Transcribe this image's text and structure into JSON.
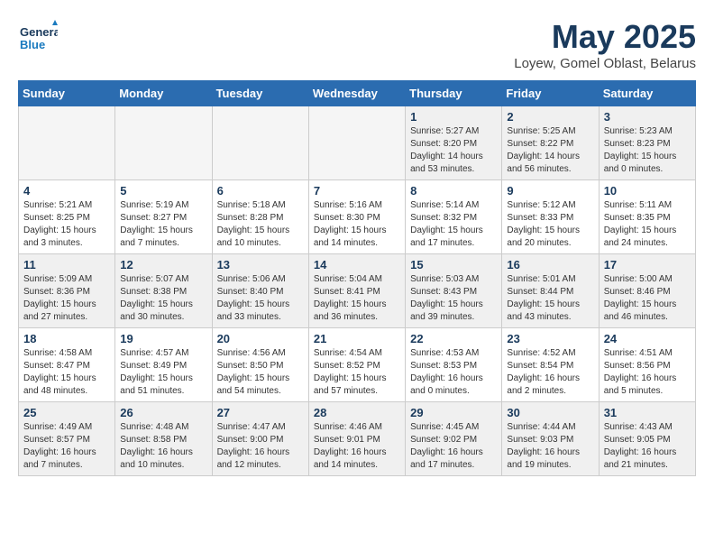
{
  "header": {
    "logo_general": "General",
    "logo_blue": "Blue",
    "month_title": "May 2025",
    "location": "Loyew, Gomel Oblast, Belarus"
  },
  "weekdays": [
    "Sunday",
    "Monday",
    "Tuesday",
    "Wednesday",
    "Thursday",
    "Friday",
    "Saturday"
  ],
  "weeks": [
    [
      {
        "num": "",
        "empty": true
      },
      {
        "num": "",
        "empty": true
      },
      {
        "num": "",
        "empty": true
      },
      {
        "num": "",
        "empty": true
      },
      {
        "num": "1",
        "line1": "Sunrise: 5:27 AM",
        "line2": "Sunset: 8:20 PM",
        "line3": "Daylight: 14 hours",
        "line4": "and 53 minutes."
      },
      {
        "num": "2",
        "line1": "Sunrise: 5:25 AM",
        "line2": "Sunset: 8:22 PM",
        "line3": "Daylight: 14 hours",
        "line4": "and 56 minutes."
      },
      {
        "num": "3",
        "line1": "Sunrise: 5:23 AM",
        "line2": "Sunset: 8:23 PM",
        "line3": "Daylight: 15 hours",
        "line4": "and 0 minutes."
      }
    ],
    [
      {
        "num": "4",
        "line1": "Sunrise: 5:21 AM",
        "line2": "Sunset: 8:25 PM",
        "line3": "Daylight: 15 hours",
        "line4": "and 3 minutes."
      },
      {
        "num": "5",
        "line1": "Sunrise: 5:19 AM",
        "line2": "Sunset: 8:27 PM",
        "line3": "Daylight: 15 hours",
        "line4": "and 7 minutes."
      },
      {
        "num": "6",
        "line1": "Sunrise: 5:18 AM",
        "line2": "Sunset: 8:28 PM",
        "line3": "Daylight: 15 hours",
        "line4": "and 10 minutes."
      },
      {
        "num": "7",
        "line1": "Sunrise: 5:16 AM",
        "line2": "Sunset: 8:30 PM",
        "line3": "Daylight: 15 hours",
        "line4": "and 14 minutes."
      },
      {
        "num": "8",
        "line1": "Sunrise: 5:14 AM",
        "line2": "Sunset: 8:32 PM",
        "line3": "Daylight: 15 hours",
        "line4": "and 17 minutes."
      },
      {
        "num": "9",
        "line1": "Sunrise: 5:12 AM",
        "line2": "Sunset: 8:33 PM",
        "line3": "Daylight: 15 hours",
        "line4": "and 20 minutes."
      },
      {
        "num": "10",
        "line1": "Sunrise: 5:11 AM",
        "line2": "Sunset: 8:35 PM",
        "line3": "Daylight: 15 hours",
        "line4": "and 24 minutes."
      }
    ],
    [
      {
        "num": "11",
        "line1": "Sunrise: 5:09 AM",
        "line2": "Sunset: 8:36 PM",
        "line3": "Daylight: 15 hours",
        "line4": "and 27 minutes."
      },
      {
        "num": "12",
        "line1": "Sunrise: 5:07 AM",
        "line2": "Sunset: 8:38 PM",
        "line3": "Daylight: 15 hours",
        "line4": "and 30 minutes."
      },
      {
        "num": "13",
        "line1": "Sunrise: 5:06 AM",
        "line2": "Sunset: 8:40 PM",
        "line3": "Daylight: 15 hours",
        "line4": "and 33 minutes."
      },
      {
        "num": "14",
        "line1": "Sunrise: 5:04 AM",
        "line2": "Sunset: 8:41 PM",
        "line3": "Daylight: 15 hours",
        "line4": "and 36 minutes."
      },
      {
        "num": "15",
        "line1": "Sunrise: 5:03 AM",
        "line2": "Sunset: 8:43 PM",
        "line3": "Daylight: 15 hours",
        "line4": "and 39 minutes."
      },
      {
        "num": "16",
        "line1": "Sunrise: 5:01 AM",
        "line2": "Sunset: 8:44 PM",
        "line3": "Daylight: 15 hours",
        "line4": "and 43 minutes."
      },
      {
        "num": "17",
        "line1": "Sunrise: 5:00 AM",
        "line2": "Sunset: 8:46 PM",
        "line3": "Daylight: 15 hours",
        "line4": "and 46 minutes."
      }
    ],
    [
      {
        "num": "18",
        "line1": "Sunrise: 4:58 AM",
        "line2": "Sunset: 8:47 PM",
        "line3": "Daylight: 15 hours",
        "line4": "and 48 minutes."
      },
      {
        "num": "19",
        "line1": "Sunrise: 4:57 AM",
        "line2": "Sunset: 8:49 PM",
        "line3": "Daylight: 15 hours",
        "line4": "and 51 minutes."
      },
      {
        "num": "20",
        "line1": "Sunrise: 4:56 AM",
        "line2": "Sunset: 8:50 PM",
        "line3": "Daylight: 15 hours",
        "line4": "and 54 minutes."
      },
      {
        "num": "21",
        "line1": "Sunrise: 4:54 AM",
        "line2": "Sunset: 8:52 PM",
        "line3": "Daylight: 15 hours",
        "line4": "and 57 minutes."
      },
      {
        "num": "22",
        "line1": "Sunrise: 4:53 AM",
        "line2": "Sunset: 8:53 PM",
        "line3": "Daylight: 16 hours",
        "line4": "and 0 minutes."
      },
      {
        "num": "23",
        "line1": "Sunrise: 4:52 AM",
        "line2": "Sunset: 8:54 PM",
        "line3": "Daylight: 16 hours",
        "line4": "and 2 minutes."
      },
      {
        "num": "24",
        "line1": "Sunrise: 4:51 AM",
        "line2": "Sunset: 8:56 PM",
        "line3": "Daylight: 16 hours",
        "line4": "and 5 minutes."
      }
    ],
    [
      {
        "num": "25",
        "line1": "Sunrise: 4:49 AM",
        "line2": "Sunset: 8:57 PM",
        "line3": "Daylight: 16 hours",
        "line4": "and 7 minutes."
      },
      {
        "num": "26",
        "line1": "Sunrise: 4:48 AM",
        "line2": "Sunset: 8:58 PM",
        "line3": "Daylight: 16 hours",
        "line4": "and 10 minutes."
      },
      {
        "num": "27",
        "line1": "Sunrise: 4:47 AM",
        "line2": "Sunset: 9:00 PM",
        "line3": "Daylight: 16 hours",
        "line4": "and 12 minutes."
      },
      {
        "num": "28",
        "line1": "Sunrise: 4:46 AM",
        "line2": "Sunset: 9:01 PM",
        "line3": "Daylight: 16 hours",
        "line4": "and 14 minutes."
      },
      {
        "num": "29",
        "line1": "Sunrise: 4:45 AM",
        "line2": "Sunset: 9:02 PM",
        "line3": "Daylight: 16 hours",
        "line4": "and 17 minutes."
      },
      {
        "num": "30",
        "line1": "Sunrise: 4:44 AM",
        "line2": "Sunset: 9:03 PM",
        "line3": "Daylight: 16 hours",
        "line4": "and 19 minutes."
      },
      {
        "num": "31",
        "line1": "Sunrise: 4:43 AM",
        "line2": "Sunset: 9:05 PM",
        "line3": "Daylight: 16 hours",
        "line4": "and 21 minutes."
      }
    ]
  ]
}
